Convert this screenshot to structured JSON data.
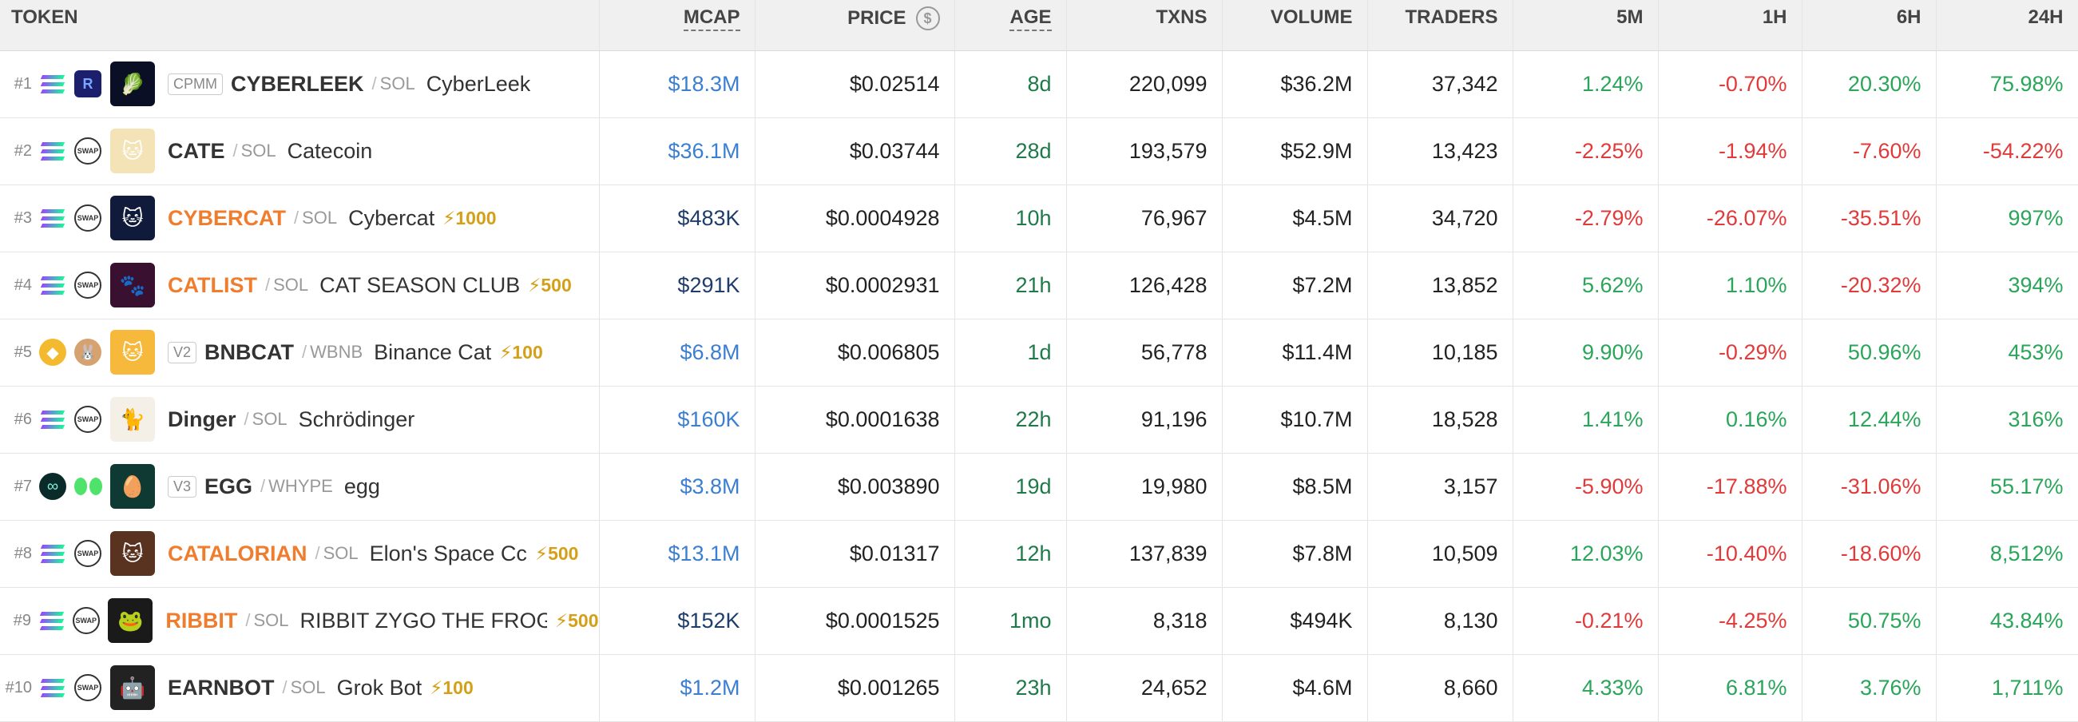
{
  "header": {
    "token": "TOKEN",
    "mcap": "MCAP",
    "price": "PRICE",
    "age": "AGE",
    "txns": "TXNS",
    "volume": "VOLUME",
    "traders": "TRADERS",
    "m5": "5M",
    "h1": "1H",
    "h6": "6H",
    "h24": "24H"
  },
  "rows": [
    {
      "rank": "#1",
      "pool": "CPMM",
      "symbol": "CYBERLEEK",
      "quote": "SOL",
      "name": "CyberLeek",
      "boost": "",
      "mcap": "$18.3M",
      "price": "$0.02514",
      "age": "8d",
      "txns": "220,099",
      "volume": "$36.2M",
      "traders": "37,342",
      "m5": "1.24%",
      "h1": "-0.70%",
      "h6": "20.30%",
      "h24": "75.98%"
    },
    {
      "rank": "#2",
      "pool": "",
      "symbol": "CATE",
      "quote": "SOL",
      "name": "Catecoin",
      "boost": "",
      "mcap": "$36.1M",
      "price": "$0.03744",
      "age": "28d",
      "txns": "193,579",
      "volume": "$52.9M",
      "traders": "13,423",
      "m5": "-2.25%",
      "h1": "-1.94%",
      "h6": "-7.60%",
      "h24": "-54.22%"
    },
    {
      "rank": "#3",
      "pool": "",
      "symbol": "CYBERCAT",
      "quote": "SOL",
      "name": "Cybercat",
      "boost": "1000",
      "mcap": "$483K",
      "price": "$0.0004928",
      "age": "10h",
      "txns": "76,967",
      "volume": "$4.5M",
      "traders": "34,720",
      "m5": "-2.79%",
      "h1": "-26.07%",
      "h6": "-35.51%",
      "h24": "997%"
    },
    {
      "rank": "#4",
      "pool": "",
      "symbol": "CATLIST",
      "quote": "SOL",
      "name": "CAT SEASON CLUB",
      "boost": "500",
      "mcap": "$291K",
      "price": "$0.0002931",
      "age": "21h",
      "txns": "126,428",
      "volume": "$7.2M",
      "traders": "13,852",
      "m5": "5.62%",
      "h1": "1.10%",
      "h6": "-20.32%",
      "h24": "394%"
    },
    {
      "rank": "#5",
      "pool": "V2",
      "symbol": "BNBCAT",
      "quote": "WBNB",
      "name": "Binance Cat",
      "boost": "100",
      "mcap": "$6.8M",
      "price": "$0.006805",
      "age": "1d",
      "txns": "56,778",
      "volume": "$11.4M",
      "traders": "10,185",
      "m5": "9.90%",
      "h1": "-0.29%",
      "h6": "50.96%",
      "h24": "453%"
    },
    {
      "rank": "#6",
      "pool": "",
      "symbol": "Dinger",
      "quote": "SOL",
      "name": "Schrödinger",
      "boost": "",
      "mcap": "$160K",
      "price": "$0.0001638",
      "age": "22h",
      "txns": "91,196",
      "volume": "$10.7M",
      "traders": "18,528",
      "m5": "1.41%",
      "h1": "0.16%",
      "h6": "12.44%",
      "h24": "316%"
    },
    {
      "rank": "#7",
      "pool": "V3",
      "symbol": "EGG",
      "quote": "WHYPE",
      "name": "egg",
      "boost": "",
      "mcap": "$3.8M",
      "price": "$0.003890",
      "age": "19d",
      "txns": "19,980",
      "volume": "$8.5M",
      "traders": "3,157",
      "m5": "-5.90%",
      "h1": "-17.88%",
      "h6": "-31.06%",
      "h24": "55.17%"
    },
    {
      "rank": "#8",
      "pool": "",
      "symbol": "CATALORIAN",
      "quote": "SOL",
      "name": "Elon's Space Cc",
      "boost": "500",
      "mcap": "$13.1M",
      "price": "$0.01317",
      "age": "12h",
      "txns": "137,839",
      "volume": "$7.8M",
      "traders": "10,509",
      "m5": "12.03%",
      "h1": "-10.40%",
      "h6": "-18.60%",
      "h24": "8,512%"
    },
    {
      "rank": "#9",
      "pool": "",
      "symbol": "RIBBIT",
      "quote": "SOL",
      "name": "RIBBIT ZYGO THE FROG",
      "boost": "500",
      "mcap": "$152K",
      "price": "$0.0001525",
      "age": "1mo",
      "txns": "8,318",
      "volume": "$494K",
      "traders": "8,130",
      "m5": "-0.21%",
      "h1": "-4.25%",
      "h6": "50.75%",
      "h24": "43.84%"
    },
    {
      "rank": "#10",
      "pool": "",
      "symbol": "EARNBOT",
      "quote": "SOL",
      "name": "Grok Bot",
      "boost": "100",
      "mcap": "$1.2M",
      "price": "$0.001265",
      "age": "23h",
      "txns": "24,652",
      "volume": "$4.6M",
      "traders": "8,660",
      "m5": "4.33%",
      "h1": "6.81%",
      "h6": "3.76%",
      "h24": "1,711%"
    }
  ],
  "colors": {
    "positive": "#2aa55a",
    "negative": "#e03a3a",
    "mcap_link": "#3c7fd1",
    "hot_symbol": "#ef7d2d",
    "boost": "#d4a017"
  }
}
